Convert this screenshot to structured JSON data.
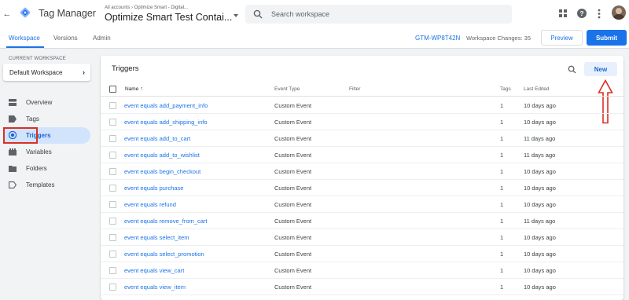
{
  "header": {
    "app_title": "Tag Manager",
    "container_sub": "All accounts › Optimize Smart - Digital...",
    "container_name": "Optimize Smart Test Contai...",
    "search_placeholder": "Search workspace"
  },
  "tabs": {
    "workspace": "Workspace",
    "versions": "Versions",
    "admin": "Admin"
  },
  "toolbar": {
    "container_id": "GTM-WP8T42N",
    "workspace_changes": "Workspace Changes: 35",
    "preview_label": "Preview",
    "submit_label": "Submit"
  },
  "sidebar": {
    "workspace_label": "CURRENT WORKSPACE",
    "workspace_name": "Default Workspace",
    "items": [
      {
        "label": "Overview",
        "icon": "overview-icon"
      },
      {
        "label": "Tags",
        "icon": "tag-icon"
      },
      {
        "label": "Triggers",
        "icon": "trigger-icon"
      },
      {
        "label": "Variables",
        "icon": "variables-icon"
      },
      {
        "label": "Folders",
        "icon": "folder-icon"
      },
      {
        "label": "Templates",
        "icon": "templates-icon"
      }
    ]
  },
  "triggers": {
    "title": "Triggers",
    "new_label": "New",
    "columns": {
      "name": "Name",
      "sort": "↑",
      "event_type": "Event Type",
      "filter": "Filter",
      "tags": "Tags",
      "last_edited": "Last Edited"
    },
    "rows": [
      {
        "name": "event equals add_payment_info",
        "event_type": "Custom Event",
        "filter": "",
        "tags": "1",
        "last_edited": "10 days ago"
      },
      {
        "name": "event equals add_shipping_info",
        "event_type": "Custom Event",
        "filter": "",
        "tags": "1",
        "last_edited": "10 days ago"
      },
      {
        "name": "event equals add_to_cart",
        "event_type": "Custom Event",
        "filter": "",
        "tags": "1",
        "last_edited": "11 days ago"
      },
      {
        "name": "event equals add_to_wishlist",
        "event_type": "Custom Event",
        "filter": "",
        "tags": "1",
        "last_edited": "11 days ago"
      },
      {
        "name": "event equals begin_checkout",
        "event_type": "Custom Event",
        "filter": "",
        "tags": "1",
        "last_edited": "10 days ago"
      },
      {
        "name": "event equals purchase",
        "event_type": "Custom Event",
        "filter": "",
        "tags": "1",
        "last_edited": "10 days ago"
      },
      {
        "name": "event equals refund",
        "event_type": "Custom Event",
        "filter": "",
        "tags": "1",
        "last_edited": "10 days ago"
      },
      {
        "name": "event equals remove_from_cart",
        "event_type": "Custom Event",
        "filter": "",
        "tags": "1",
        "last_edited": "11 days ago"
      },
      {
        "name": "event equals select_item",
        "event_type": "Custom Event",
        "filter": "",
        "tags": "1",
        "last_edited": "10 days ago"
      },
      {
        "name": "event equals select_promotion",
        "event_type": "Custom Event",
        "filter": "",
        "tags": "1",
        "last_edited": "10 days ago"
      },
      {
        "name": "event equals view_cart",
        "event_type": "Custom Event",
        "filter": "",
        "tags": "1",
        "last_edited": "10 days ago"
      },
      {
        "name": "event equals view_item",
        "event_type": "Custom Event",
        "filter": "",
        "tags": "1",
        "last_edited": "10 days ago"
      }
    ]
  },
  "colors": {
    "accent": "#1a73e8",
    "annotation_red": "#d93025",
    "sidebar_bg": "#f1f3f4",
    "active_nav_bg": "#d2e3fc"
  }
}
